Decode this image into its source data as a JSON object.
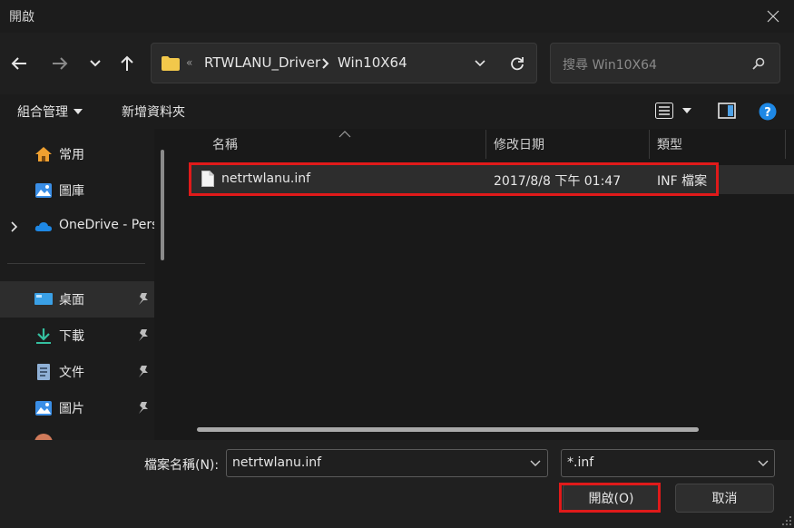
{
  "window": {
    "title": "開啟"
  },
  "address": {
    "crumbs": [
      "RTWLANU_Driver",
      "Win10X64"
    ],
    "overflow": "«"
  },
  "search": {
    "placeholder": "搜尋 Win10X64"
  },
  "command_bar": {
    "organize": "組合管理",
    "new_folder": "新增資料夾"
  },
  "nav": {
    "items": [
      {
        "label": "常用",
        "icon": "home-icon"
      },
      {
        "label": "圖庫",
        "icon": "gallery-icon"
      },
      {
        "label": "OneDrive - Pers",
        "icon": "onedrive-icon"
      },
      {
        "label": "桌面",
        "icon": "desktop-icon",
        "pinned": true
      },
      {
        "label": "下載",
        "icon": "download-icon",
        "pinned": true
      },
      {
        "label": "文件",
        "icon": "document-icon",
        "pinned": true
      },
      {
        "label": "圖片",
        "icon": "pictures-icon",
        "pinned": true
      }
    ]
  },
  "columns": {
    "name": "名稱",
    "modified": "修改日期",
    "type": "類型"
  },
  "files": [
    {
      "name": "netrtwlanu.inf",
      "modified": "2017/8/8 下午 01:47",
      "type": "INF 檔案"
    }
  ],
  "bottom": {
    "filename_label": "檔案名稱(N):",
    "filename_value": "netrtwlanu.inf",
    "filetype_value": "*.inf",
    "open_button": "開啟(O)",
    "cancel_button": "取消"
  },
  "colors": {
    "highlight": "#e01a1a",
    "folder": "#f2c84b",
    "accent": "#1e88e5"
  }
}
